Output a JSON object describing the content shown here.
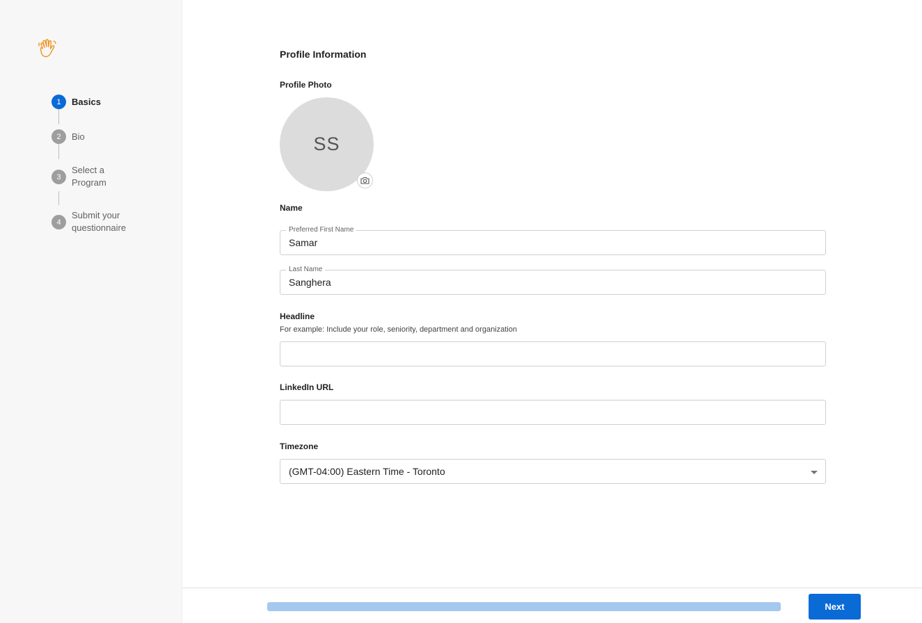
{
  "steps": [
    {
      "number": "1",
      "label": "Basics",
      "active": true
    },
    {
      "number": "2",
      "label": "Bio",
      "active": false
    },
    {
      "number": "3",
      "label": "Select a Program",
      "active": false
    },
    {
      "number": "4",
      "label": "Submit your questionnaire",
      "active": false
    }
  ],
  "form": {
    "section_title": "Profile Information",
    "photo_label": "Profile Photo",
    "avatar_initials": "SS",
    "name_label": "Name",
    "first_name": {
      "legend": "Preferred First Name",
      "value": "Samar"
    },
    "last_name": {
      "legend": "Last Name",
      "value": "Sanghera"
    },
    "headline": {
      "label": "Headline",
      "hint": "For example: Include your role, seniority, department and organization",
      "value": ""
    },
    "linkedin": {
      "label": "LinkedIn URL",
      "value": ""
    },
    "timezone": {
      "label": "Timezone",
      "selected": "(GMT-04:00) Eastern Time - Toronto"
    }
  },
  "footer": {
    "next_label": "Next",
    "progress_fraction": 1.0
  },
  "colors": {
    "accent": "#0a6ad6",
    "logo": "#f0931f",
    "progress": "#a5c8ef"
  },
  "icons": {
    "logo": "waving-hand-icon",
    "camera": "camera-icon",
    "dropdown": "chevron-down-icon"
  }
}
